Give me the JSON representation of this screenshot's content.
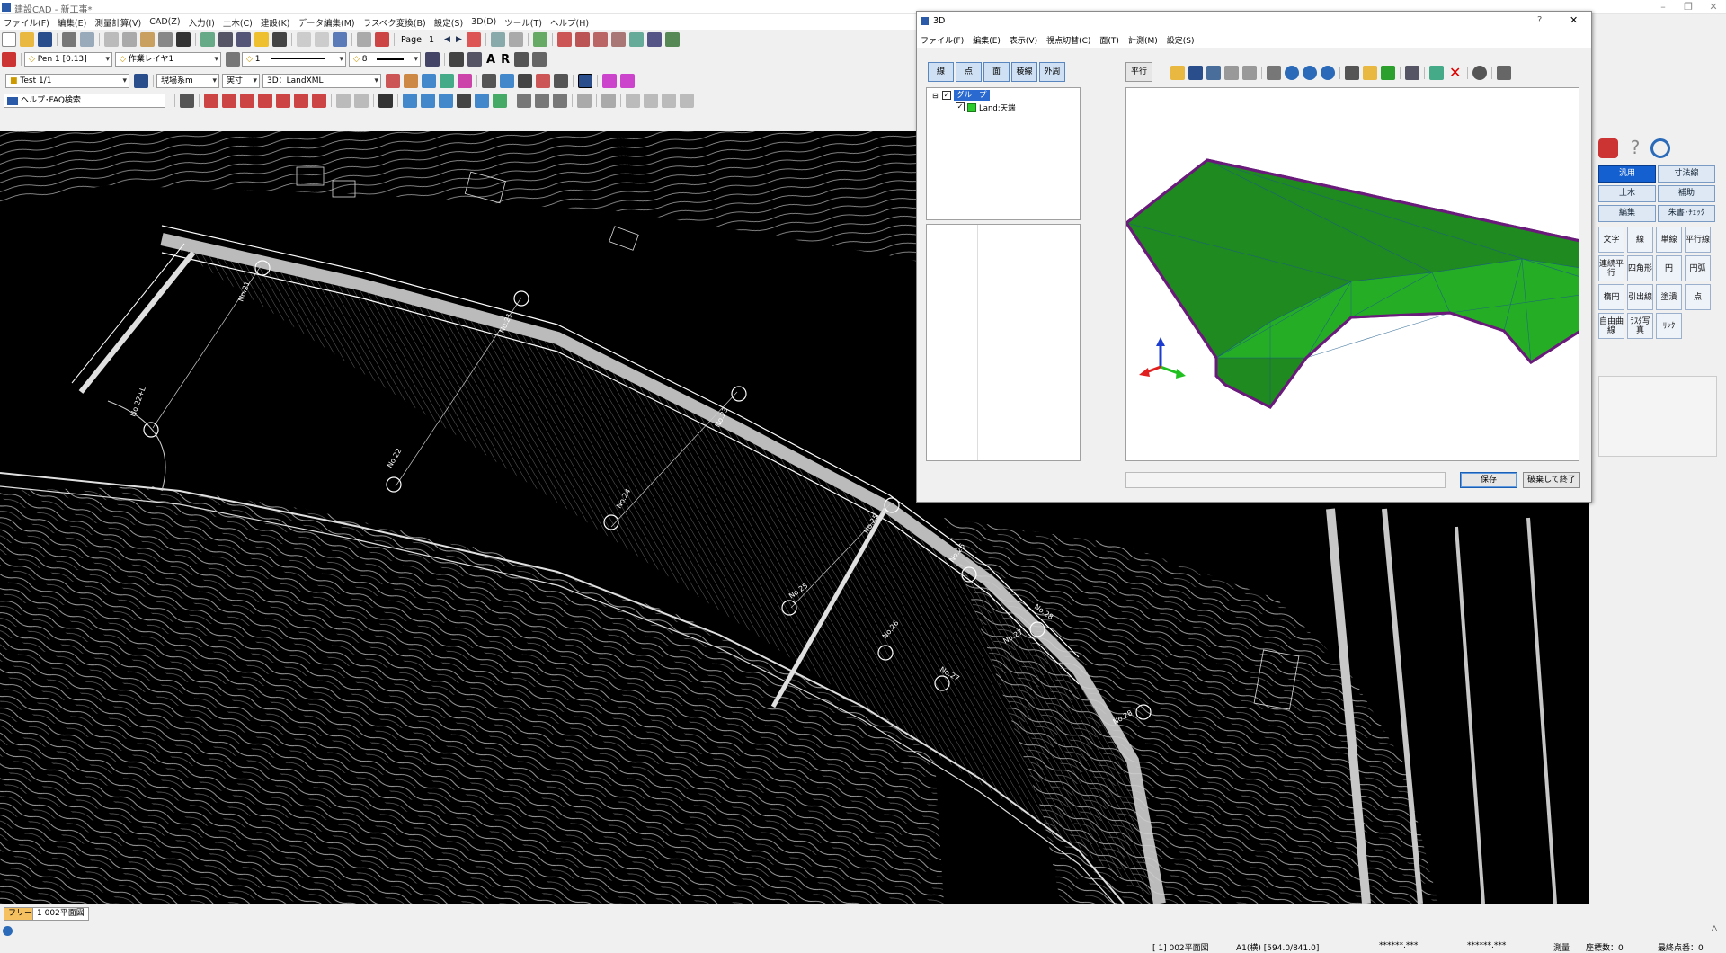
{
  "window": {
    "title": "建設CAD - 新工事*",
    "controls": [
      "–",
      "❐",
      "✕"
    ]
  },
  "menu": [
    "ファイル(F)",
    "編集(E)",
    "測量計算(V)",
    "CAD(Z)",
    "入力(I)",
    "土木(C)",
    "建設(K)",
    "データ編集(M)",
    "ラスベク変換(B)",
    "設定(S)",
    "3D(D)",
    "ツール(T)",
    "ヘルプ(H)"
  ],
  "toolbar1": {
    "page_label": "Page",
    "page_value": "1"
  },
  "toolbar2": {
    "pen": "Pen 1 [0.13]",
    "layer": "作業レイヤ1",
    "linetype": "1",
    "linewidth": "8"
  },
  "toolbar3": {
    "sheet": "Test 1/1",
    "scale": "現場系m",
    "unit": "実寸",
    "view": "3D：LandXML"
  },
  "toolbar4": {
    "help_search": "ヘルプ･FAQ検索"
  },
  "dialog3d": {
    "title": "3D",
    "help": "?",
    "close": "✕",
    "menu": [
      "ファイル(F)",
      "編集(E)",
      "表示(V)",
      "視点切替(C)",
      "面(T)",
      "計測(M)",
      "設定(S)"
    ],
    "mode_buttons": [
      "線",
      "点",
      "面",
      "稜線",
      "外周"
    ],
    "parallel_button": "平行",
    "tree": {
      "group_label": "グループ",
      "child_label": "Land:天端"
    },
    "save_button": "保存",
    "discard_button": "破棄して終了",
    "mesh_color": "#1f8a1f",
    "mesh_color_light": "#26b026",
    "outline_color": "#6a1a7a"
  },
  "palette": {
    "tabs": [
      {
        "label": "汎用",
        "selected": true
      },
      {
        "label": "寸法線",
        "selected": false
      },
      {
        "label": "土木",
        "selected": false
      },
      {
        "label": "補助",
        "selected": false
      },
      {
        "label": "編集",
        "selected": false
      },
      {
        "label": "朱書･ﾁｪｯｸ",
        "selected": false
      }
    ],
    "tools": [
      "文字",
      "線",
      "単線",
      "平行線",
      "連続平行",
      "四角形",
      "円",
      "円弧",
      "楕円",
      "引出線",
      "塗潰",
      "点",
      "自由曲線",
      "ﾗｽﾀ写真",
      "ﾘﾝｸ"
    ]
  },
  "canvas": {
    "station_labels": [
      "No.21",
      "No.21",
      "No.22",
      "No.22+L",
      "No.23",
      "No.24",
      "No.25",
      "No.25",
      "No.26",
      "No.26",
      "No.27",
      "No.27",
      "No.28",
      "No.28"
    ],
    "background": "#000000",
    "line_color": "#d8d8d8"
  },
  "tabs": {
    "free_tab": "フリー",
    "sheet_tab": "1  002平面図"
  },
  "status": {
    "drawing": "[ 1] 002平面図",
    "paper": "A1(横) [594.0/841.0]",
    "coord_x": "******.***",
    "coord_y": "******.***",
    "mode": "測量",
    "coord_count": "座標数：0",
    "last_point": "最終点番：0"
  }
}
